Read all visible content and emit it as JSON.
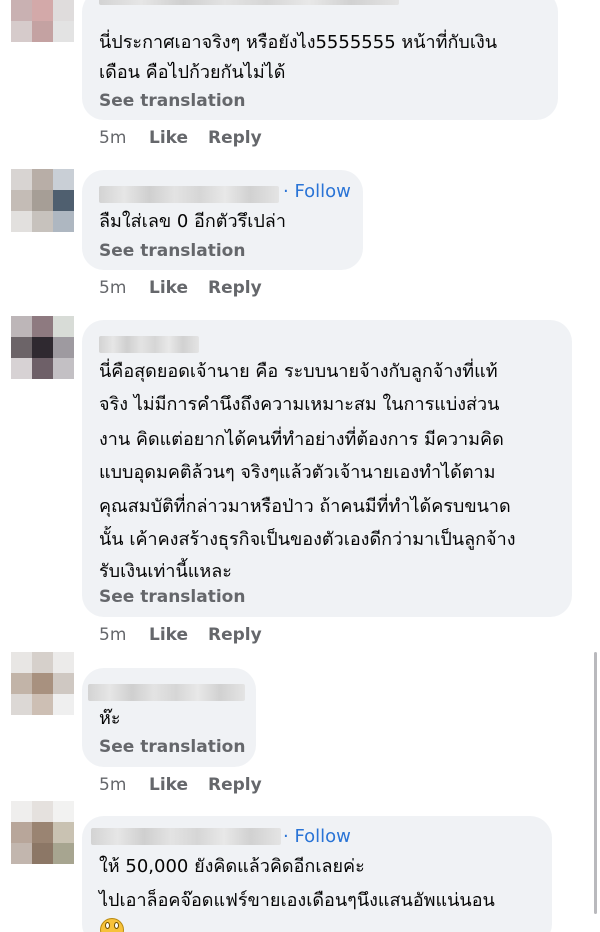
{
  "comments": [
    {
      "lines": [
        "นี่ประกาศเอาจริงๆ หรือยังไง5555555 หน้าที่กับเงิน",
        "เดือน คือไปก้วยกันไม่ได้"
      ],
      "see_translation": "See translation",
      "time": "5m",
      "like": "Like",
      "reply": "Reply"
    },
    {
      "follow": "· Follow",
      "lines": [
        "ลืมใส่เลข 0 อีกตัวรึเปล่า"
      ],
      "see_translation": "See translation",
      "time": "5m",
      "like": "Like",
      "reply": "Reply"
    },
    {
      "lines": [
        "นี่คือสุดยอดเจ้านาย คือ ระบบนายจ้างกับลูกจ้างที่แท้",
        "จริง ไม่มีการคำนึงถึงความเหมาะสม ในการแบ่งส่วน",
        "งาน คิดแต่อยากได้คนที่ทำอย่างที่ต้องการ มีความคิด",
        "แบบอุดมคติล้วนๆ จริงๆแล้วตัวเจ้านายเองทำได้ตาม",
        "คุณสมบัติที่กล่าวมาหรือป่าว ถ้าคนมีที่ทำได้ครบขนาด",
        "นั้น เค้าคงสร้างธุรกิจเป็นของตัวเองดีกว่ามาเป็นลูกจ้าง",
        "รับเงินเท่านี้แหละ"
      ],
      "see_translation": "See translation",
      "time": "5m",
      "like": "Like",
      "reply": "Reply"
    },
    {
      "lines": [
        "ห๊ะ"
      ],
      "see_translation": "See translation",
      "time": "5m",
      "like": "Like",
      "reply": "Reply"
    },
    {
      "follow": "· Follow",
      "lines": [
        "ให้ 50,000 ยังคิดแล้วคิดอีกเลยค่ะ",
        "ไปเอาล็อคจ๊อดแฟร์ขายเองเดือนๆนึงแสนอัพแน่นอน"
      ],
      "emoji": "face-screaming-in-fear-emoji"
    }
  ]
}
